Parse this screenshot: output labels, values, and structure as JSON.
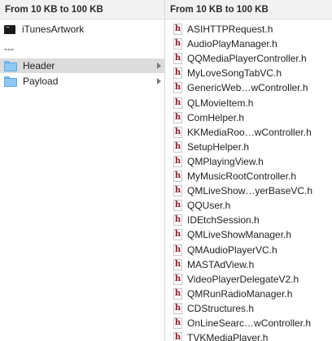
{
  "columns": {
    "left_header": "From 10 KB to 100 KB",
    "right_header": "From 10 KB to 100 KB"
  },
  "left_items": [
    {
      "label": "iTunesArtwork",
      "icon": "executable-file-icon"
    },
    {
      "label": "---",
      "icon": ""
    },
    {
      "label": "Header",
      "icon": "folder-icon",
      "selected": true,
      "has_children": true
    },
    {
      "label": "Payload",
      "icon": "folder-icon",
      "selected": false,
      "has_children": true
    }
  ],
  "header_glyph": "h",
  "right_items": [
    "ASIHTTPRequest.h",
    "AudioPlayManager.h",
    "QQMediaPlayerController.h",
    "MyLoveSongTabVC.h",
    "GenericWeb…wController.h",
    "QLMovieItem.h",
    "ComHelper.h",
    "KKMediaRoo…wController.h",
    "SetupHelper.h",
    "QMPlayingView.h",
    "MyMusicRootController.h",
    "QMLiveShow…yerBaseVC.h",
    "QQUser.h",
    "IDEtchSession.h",
    "QMLiveShowManager.h",
    "QMAudioPlayerVC.h",
    "MASTAdView.h",
    "VideoPlayerDelegateV2.h",
    "QMRunRadioManager.h",
    "CDStructures.h",
    "OnLineSearc…wController.h",
    "TVKMediaPlayer.h"
  ],
  "colors": {
    "selection": "#dcdcdc",
    "folder": "#8fc8f4",
    "header_icon_letter": "#8e1e2e"
  }
}
